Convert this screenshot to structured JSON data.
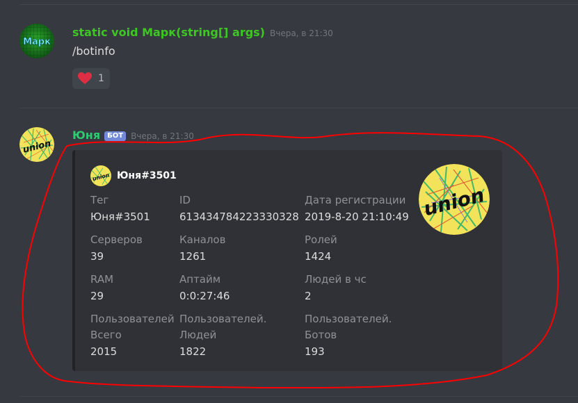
{
  "messages": [
    {
      "author": "static void Марк(string[] args)",
      "author_color": "#3ec724",
      "timestamp": "Вчера, в 21:30",
      "avatar_text": "Марк",
      "content": "/botinfo",
      "reaction": {
        "icon": "heart-icon",
        "count": "1",
        "color": "#dd2e44"
      }
    },
    {
      "author": "Юня",
      "author_color": "#2ecc71",
      "badge": "БОТ",
      "timestamp": "Вчера, в 21:30",
      "avatar_text": "union",
      "embed": {
        "author_name": "Юня#3501",
        "thumbnail_text": "union",
        "fields": [
          {
            "name": "Тег",
            "value": "Юня#3501"
          },
          {
            "name": "ID",
            "value": "613434784223330328"
          },
          {
            "name": "Дата регистрации",
            "value": "2019-8-20 21:10:49"
          },
          {
            "name": "Серверов",
            "value": "39"
          },
          {
            "name": "Каналов",
            "value": "1261"
          },
          {
            "name": "Ролей",
            "value": "1424"
          },
          {
            "name": "RAM",
            "value": "29"
          },
          {
            "name": "Аптайм",
            "value": "0:0:27:46"
          },
          {
            "name": "Людей в чс",
            "value": "2"
          },
          {
            "name": "Пользователей Всего",
            "name_line1": "Пользователей",
            "name_line2": "Всего",
            "value": "2015"
          },
          {
            "name": "Пользователей. Людей",
            "name_line1": "Пользователей.",
            "name_line2": "Людей",
            "value": "1822"
          },
          {
            "name": "Пользователей. Ботов",
            "name_line1": "Пользователей.",
            "name_line2": "Ботов",
            "value": "193"
          }
        ]
      }
    }
  ],
  "colors": {
    "background": "#36393f",
    "embed_bg": "#2f3136",
    "highlight_stroke": "#ff0000",
    "bot_badge": "#7289da"
  }
}
